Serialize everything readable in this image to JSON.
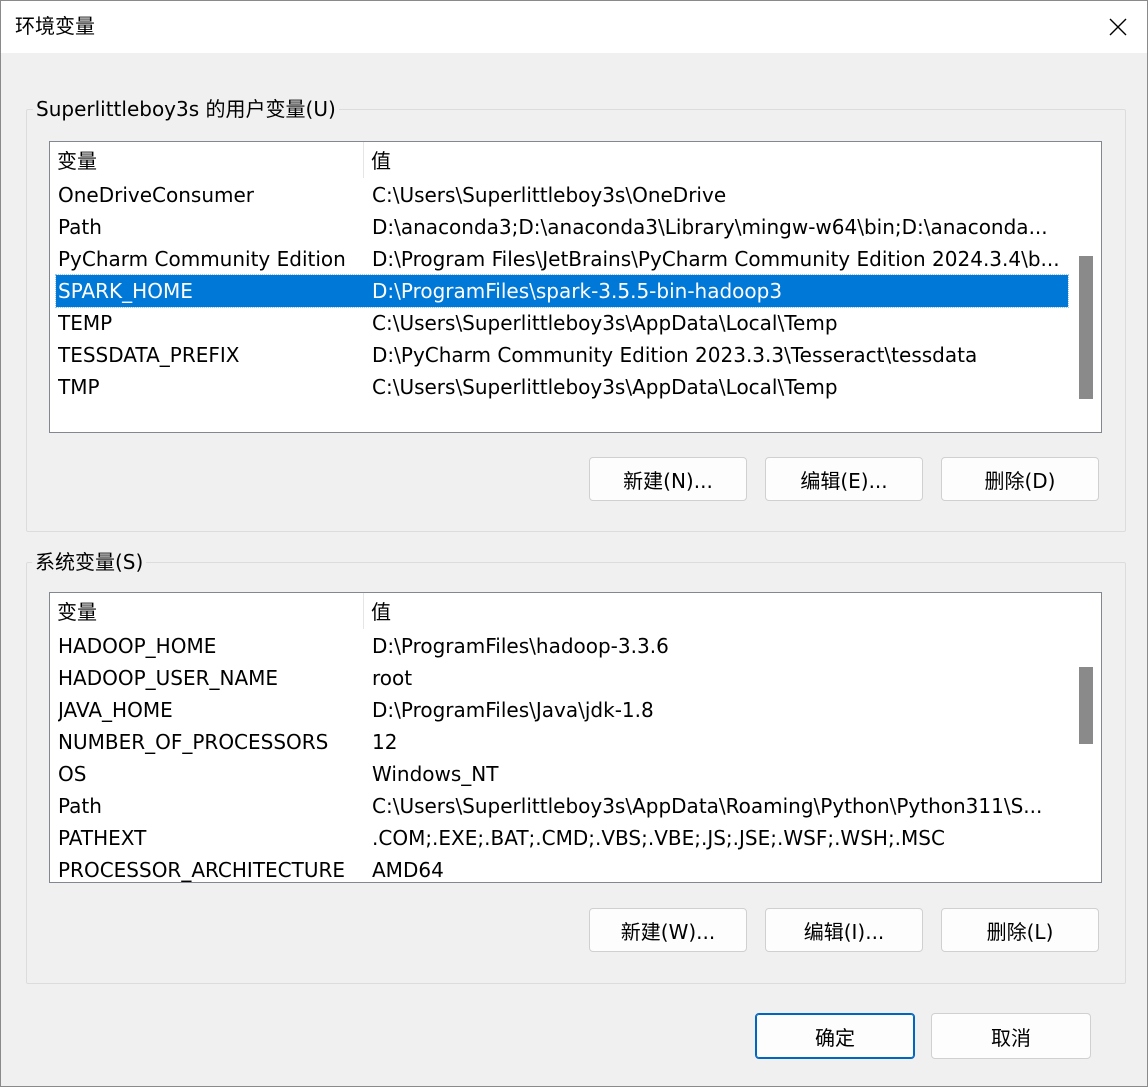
{
  "window": {
    "title": "环境变量",
    "close_icon": "close-icon"
  },
  "user_vars": {
    "group_label": "Superlittleboy3s 的用户变量(U)",
    "columns": [
      "变量",
      "值"
    ],
    "rows": [
      {
        "name": "OneDriveConsumer",
        "value": "C:\\Users\\Superlittleboy3s\\OneDrive"
      },
      {
        "name": "Path",
        "value": "D:\\anaconda3;D:\\anaconda3\\Library\\mingw-w64\\bin;D:\\anaconda..."
      },
      {
        "name": "PyCharm Community Edition",
        "value": "D:\\Program Files\\JetBrains\\PyCharm Community Edition 2024.3.4\\b..."
      },
      {
        "name": "SPARK_HOME",
        "value": "D:\\ProgramFiles\\spark-3.5.5-bin-hadoop3"
      },
      {
        "name": "TEMP",
        "value": "C:\\Users\\Superlittleboy3s\\AppData\\Local\\Temp"
      },
      {
        "name": "TESSDATA_PREFIX",
        "value": "D:\\PyCharm Community Edition 2023.3.3\\Tesseract\\tessdata"
      },
      {
        "name": "TMP",
        "value": "C:\\Users\\Superlittleboy3s\\AppData\\Local\\Temp"
      }
    ],
    "selected_index": 3,
    "buttons": {
      "new": "新建(N)...",
      "edit": "编辑(E)...",
      "delete": "删除(D)"
    }
  },
  "system_vars": {
    "group_label": "系统变量(S)",
    "columns": [
      "变量",
      "值"
    ],
    "rows": [
      {
        "name": "HADOOP_HOME",
        "value": "D:\\ProgramFiles\\hadoop-3.3.6"
      },
      {
        "name": "HADOOP_USER_NAME",
        "value": "root"
      },
      {
        "name": "JAVA_HOME",
        "value": "D:\\ProgramFiles\\Java\\jdk-1.8"
      },
      {
        "name": "NUMBER_OF_PROCESSORS",
        "value": "12"
      },
      {
        "name": "OS",
        "value": "Windows_NT"
      },
      {
        "name": "Path",
        "value": "C:\\Users\\Superlittleboy3s\\AppData\\Roaming\\Python\\Python311\\S..."
      },
      {
        "name": "PATHEXT",
        "value": ".COM;.EXE;.BAT;.CMD;.VBS;.VBE;.JS;.JSE;.WSF;.WSH;.MSC"
      },
      {
        "name": "PROCESSOR_ARCHITECTURE",
        "value": "AMD64"
      }
    ],
    "buttons": {
      "new": "新建(W)...",
      "edit": "编辑(I)...",
      "delete": "删除(L)"
    }
  },
  "footer": {
    "ok": "确定",
    "cancel": "取消"
  },
  "colors": {
    "selection": "#0078d7",
    "default_button_border": "#0067c0",
    "scroll_thumb": "#8a8a8a"
  }
}
